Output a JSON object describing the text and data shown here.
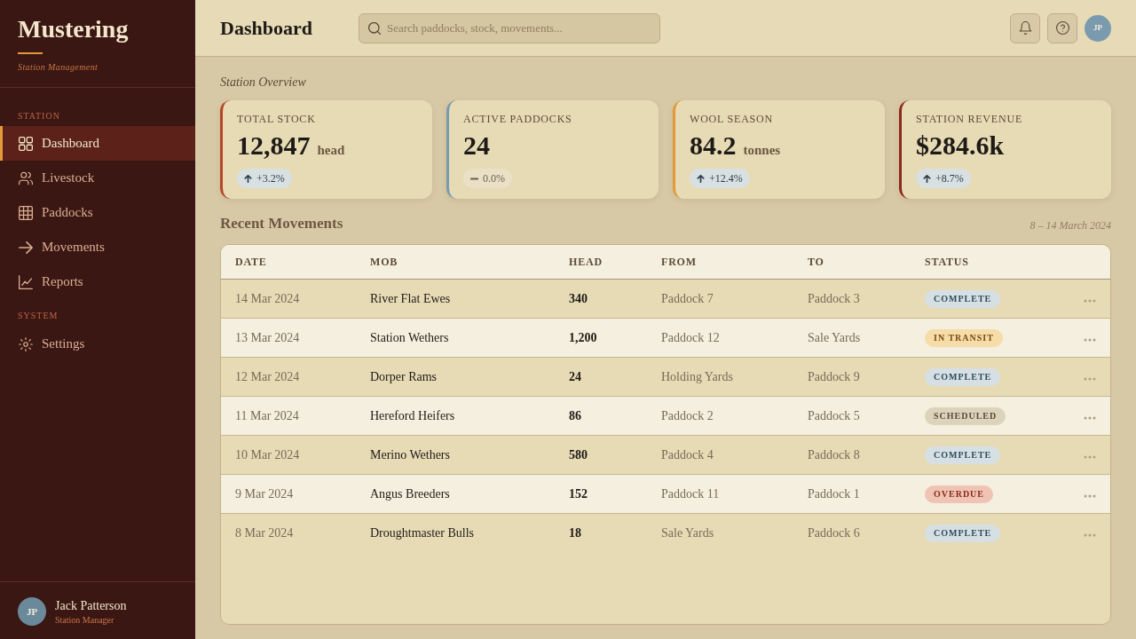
{
  "sidebar": {
    "brand": "Mustering",
    "tagline": "Station Management",
    "sections": [
      {
        "heading": "STATION",
        "items": [
          {
            "label": "Dashboard",
            "selected": true
          },
          {
            "label": "Livestock",
            "selected": false
          },
          {
            "label": "Paddocks",
            "selected": false
          },
          {
            "label": "Movements",
            "selected": false
          },
          {
            "label": "Reports",
            "selected": false
          }
        ]
      },
      {
        "heading": "SYSTEM",
        "items": [
          {
            "label": "Settings",
            "selected": false
          }
        ]
      }
    ],
    "user": {
      "initials": "JP",
      "name": "Jack Patterson",
      "role": "Station Manager"
    }
  },
  "header": {
    "title": "Dashboard",
    "search": {
      "placeholder": "Search paddocks, stock, movements..."
    },
    "avatar_initials": "JP"
  },
  "overview": {
    "title": "Station Overview",
    "cards": [
      {
        "label": "TOTAL STOCK",
        "value": "12,847",
        "unit": "head",
        "change": {
          "text": "+3.2%",
          "kind": "up"
        },
        "color": "#b5462a"
      },
      {
        "label": "ACTIVE PADDOCKS",
        "value": "24",
        "change": {
          "text": "0.0%",
          "kind": "flat"
        },
        "color": "#7a9aae"
      },
      {
        "label": "WOOL SEASON",
        "value": "84.2",
        "unit": "tonnes",
        "change": {
          "text": "+12.4%",
          "kind": "up"
        },
        "color": "#e29a3a"
      },
      {
        "label": "STATION REVENUE",
        "value": "$284.6k",
        "change": {
          "text": "+8.7%",
          "kind": "up"
        },
        "color": "#8a2a1c"
      }
    ]
  },
  "movements": {
    "title": "Recent Movements",
    "range": "8 – 14 March 2024",
    "columns": [
      "DATE",
      "MOB",
      "HEAD",
      "FROM",
      "TO",
      "STATUS"
    ],
    "rows": [
      {
        "date": "14 Mar 2024",
        "mob": "River Flat Ewes",
        "head": "340",
        "from": "Paddock 7",
        "to": "Paddock 3",
        "status": {
          "label": "COMPLETE",
          "kind": "complete"
        }
      },
      {
        "date": "13 Mar 2024",
        "mob": "Station Wethers",
        "head": "1,200",
        "from": "Paddock 12",
        "to": "Sale Yards",
        "status": {
          "label": "IN TRANSIT",
          "kind": "transit"
        }
      },
      {
        "date": "12 Mar 2024",
        "mob": "Dorper Rams",
        "head": "24",
        "from": "Holding Yards",
        "to": "Paddock 9",
        "status": {
          "label": "COMPLETE",
          "kind": "complete"
        }
      },
      {
        "date": "11 Mar 2024",
        "mob": "Hereford Heifers",
        "head": "86",
        "from": "Paddock 2",
        "to": "Paddock 5",
        "status": {
          "label": "SCHEDULED",
          "kind": "scheduled"
        }
      },
      {
        "date": "10 Mar 2024",
        "mob": "Merino Wethers",
        "head": "580",
        "from": "Paddock 4",
        "to": "Paddock 8",
        "status": {
          "label": "COMPLETE",
          "kind": "complete"
        }
      },
      {
        "date": "9 Mar 2024",
        "mob": "Angus Breeders",
        "head": "152",
        "from": "Paddock 11",
        "to": "Paddock 1",
        "status": {
          "label": "OVERDUE",
          "kind": "overdue"
        }
      },
      {
        "date": "8 Mar 2024",
        "mob": "Droughtmaster Bulls",
        "head": "18",
        "from": "Sale Yards",
        "to": "Paddock 6",
        "status": {
          "label": "COMPLETE",
          "kind": "complete"
        }
      }
    ]
  }
}
